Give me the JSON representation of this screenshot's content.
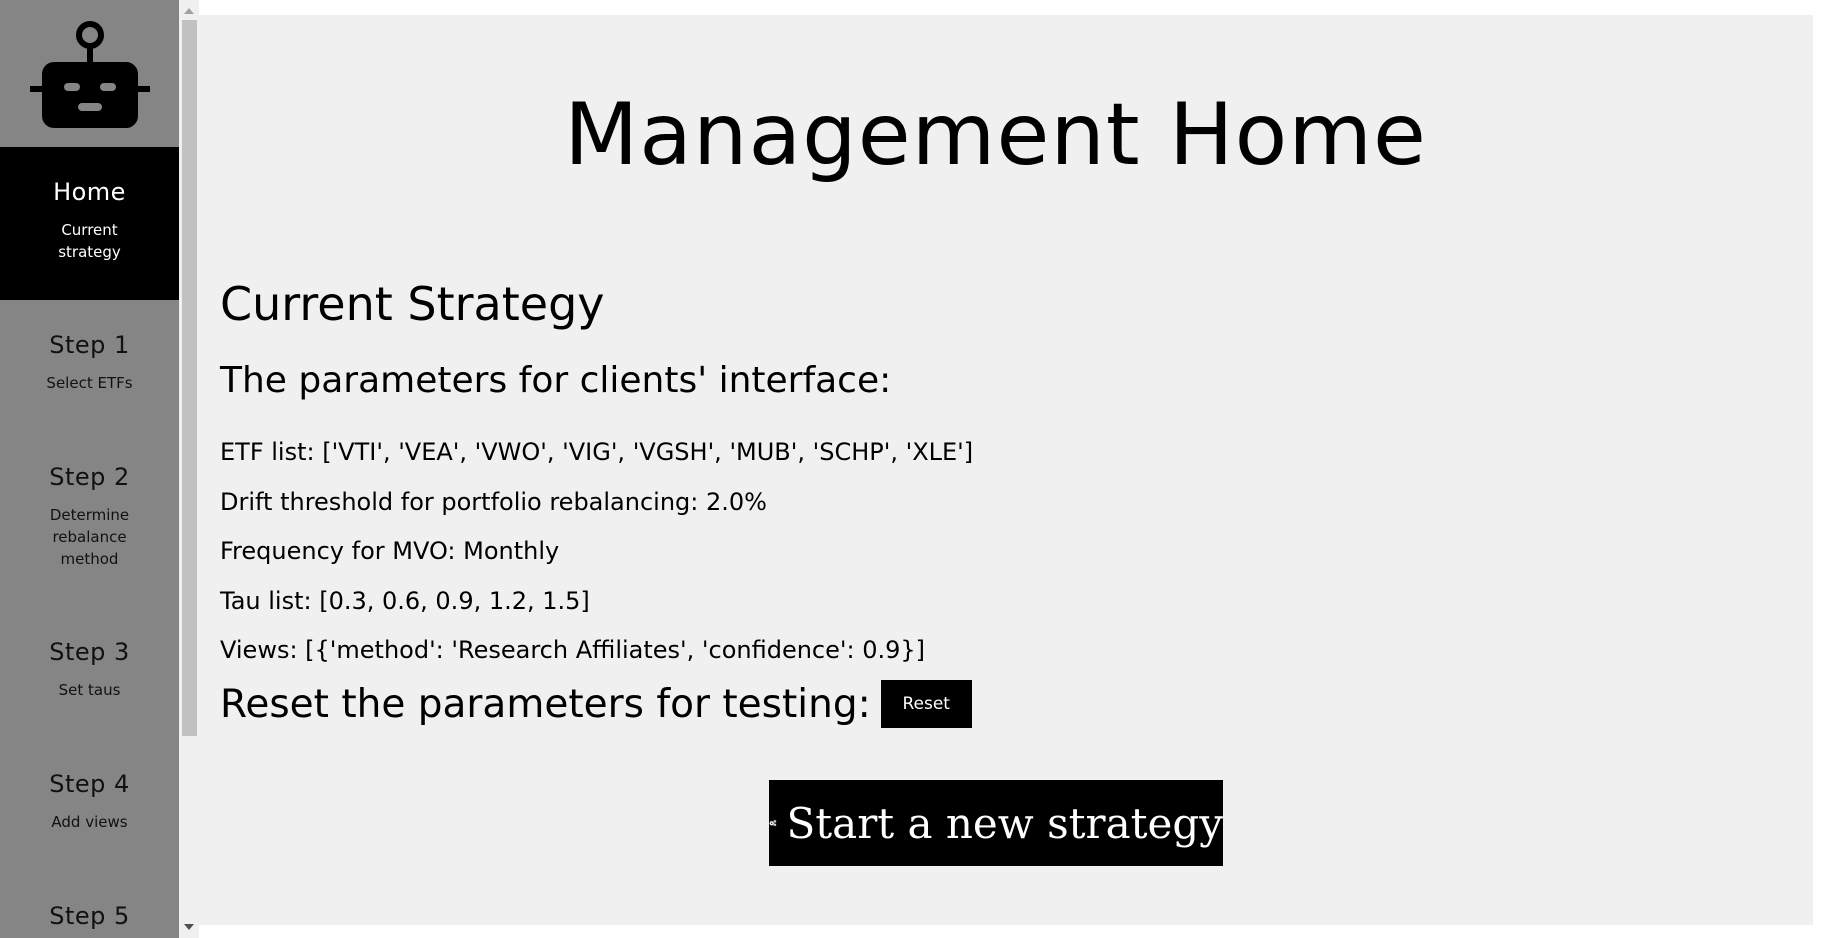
{
  "sidebar": {
    "logo_icon": "robot-icon",
    "items": [
      {
        "title": "Home",
        "subtitle": "Current\nstrategy",
        "active": true
      },
      {
        "title": "Step 1",
        "subtitle": "Select ETFs"
      },
      {
        "title": "Step 2",
        "subtitle": "Determine rebalance method"
      },
      {
        "title": "Step 3",
        "subtitle": "Set taus"
      },
      {
        "title": "Step 4",
        "subtitle": "Add views"
      },
      {
        "title": "Step 5",
        "subtitle": ""
      }
    ]
  },
  "main": {
    "page_title": "Management Home",
    "section_title": "Current Strategy",
    "params_heading": "The parameters for clients' interface:",
    "params": [
      "ETF list: ['VTI', 'VEA', 'VWO', 'VIG', 'VGSH', 'MUB', 'SCHP', 'XLE']",
      "Drift threshold for portfolio rebalancing: 2.0%",
      "Frequency for MVO: Monthly",
      "Tau list: [0.3, 0.6, 0.9, 1.2, 1.5]",
      "Views: [{'method': 'Research Affiliates', 'confidence': 0.9}]"
    ],
    "reset_label": "Reset the parameters for testing:",
    "reset_button": "Reset",
    "start_button": "Start a new strategy",
    "start_icon": "gears-icon"
  },
  "colors": {
    "sidebar_bg": "#858585",
    "active_bg": "#000000",
    "main_bg": "#f0f0f0",
    "button_bg": "#000000",
    "button_text": "#ffffff"
  }
}
